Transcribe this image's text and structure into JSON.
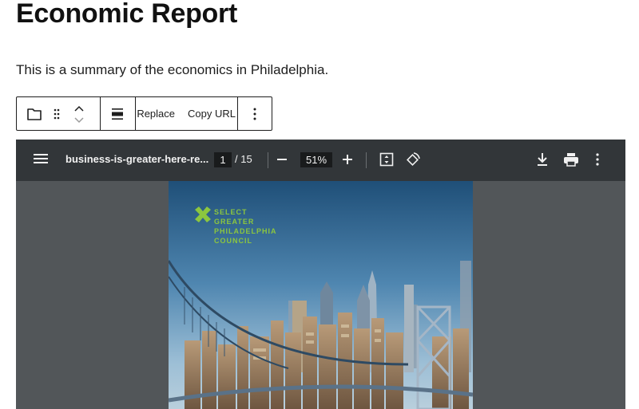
{
  "page": {
    "title": "Economic Report",
    "summary": "This is a summary of the economics in Philadelphia."
  },
  "toolbar": {
    "replace_label": "Replace",
    "copy_url_label": "Copy URL",
    "icons": [
      "folder-icon",
      "drag-handle-icon",
      "chevron-up-icon",
      "chevron-down-icon",
      "align-icon",
      "more-vertical-icon"
    ]
  },
  "pdf_viewer": {
    "filename": "business-is-greater-here-re...",
    "current_page": "1",
    "total_pages": "/ 15",
    "zoom": "51%",
    "icons": [
      "menu-icon",
      "zoom-out-icon",
      "zoom-in-icon",
      "fit-page-icon",
      "rotate-icon",
      "download-icon",
      "print-icon",
      "more-vertical-icon"
    ]
  },
  "pdf_page": {
    "logo_lines": [
      "SELECT",
      "GREATER",
      "PHILADELPHIA",
      "COUNCIL"
    ],
    "logo_color": "#8cc63f"
  },
  "colors": {
    "viewer_toolbar": "#323639",
    "viewer_background": "#525659"
  }
}
